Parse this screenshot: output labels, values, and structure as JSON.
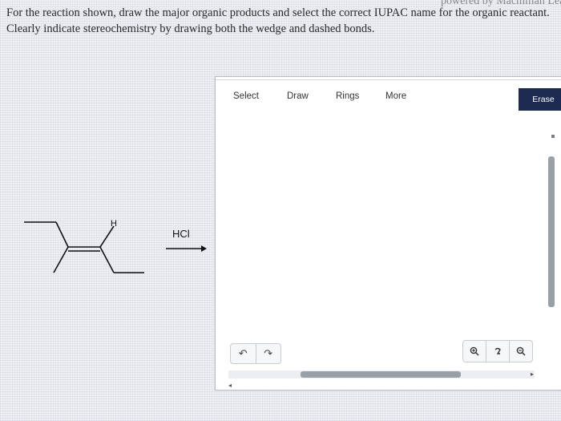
{
  "question": {
    "line1": "For the reaction shown, draw the major organic products and select the correct IUPAC name for the organic reactant.",
    "line2": "Clearly indicate stereochemistry by drawing both the wedge and dashed bonds."
  },
  "header": {
    "partial_text": "powered by Macmillan Learning"
  },
  "reaction": {
    "reagent": "HCl",
    "h_label": "H"
  },
  "toolbar": {
    "select_label": "Select",
    "draw_label": "Draw",
    "rings_label": "Rings",
    "more_label": "More",
    "erase_label": "Erase"
  },
  "icons": {
    "undo": "undo-icon",
    "redo": "redo-icon",
    "zoom_in": "zoom-in-icon",
    "zoom_reset": "zoom-reset-icon",
    "zoom_out": "zoom-out-icon"
  },
  "colors": {
    "erase_bg": "#1b2a4e"
  }
}
